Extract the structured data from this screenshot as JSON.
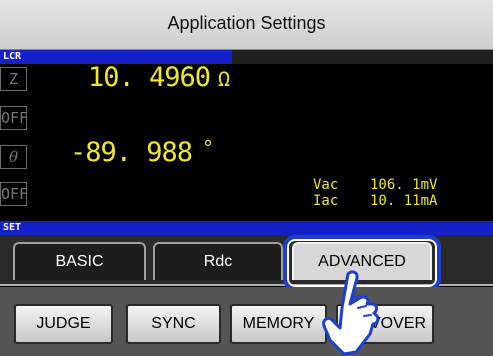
{
  "window": {
    "title": "Application Settings"
  },
  "lcr_section": {
    "label": "LCR"
  },
  "measurements": {
    "param1": {
      "name": "Z",
      "value": "10. 4960",
      "unit": "Ω"
    },
    "param2": {
      "name": "OFF"
    },
    "param3": {
      "name": "θ",
      "value": "-89. 988",
      "unit": "°"
    },
    "param4": {
      "name": "OFF"
    },
    "monitor": [
      {
        "label": "Vac",
        "value": "106. 1mV"
      },
      {
        "label": "Iac",
        "value": "10. 11mA"
      }
    ]
  },
  "set_section": {
    "label": "SET"
  },
  "tabs": [
    {
      "label": "BASIC",
      "active": false
    },
    {
      "label": "Rdc",
      "active": false
    },
    {
      "label": "ADVANCED",
      "active": true
    }
  ],
  "buttons": [
    {
      "label": "JUDGE"
    },
    {
      "label": "SYNC"
    },
    {
      "label": "MEMORY"
    },
    {
      "label": "C.VOVER"
    }
  ],
  "colors": {
    "value_text": "#f0e72a",
    "header_blue": "#1420c8",
    "highlight": "#1d3fd0"
  }
}
